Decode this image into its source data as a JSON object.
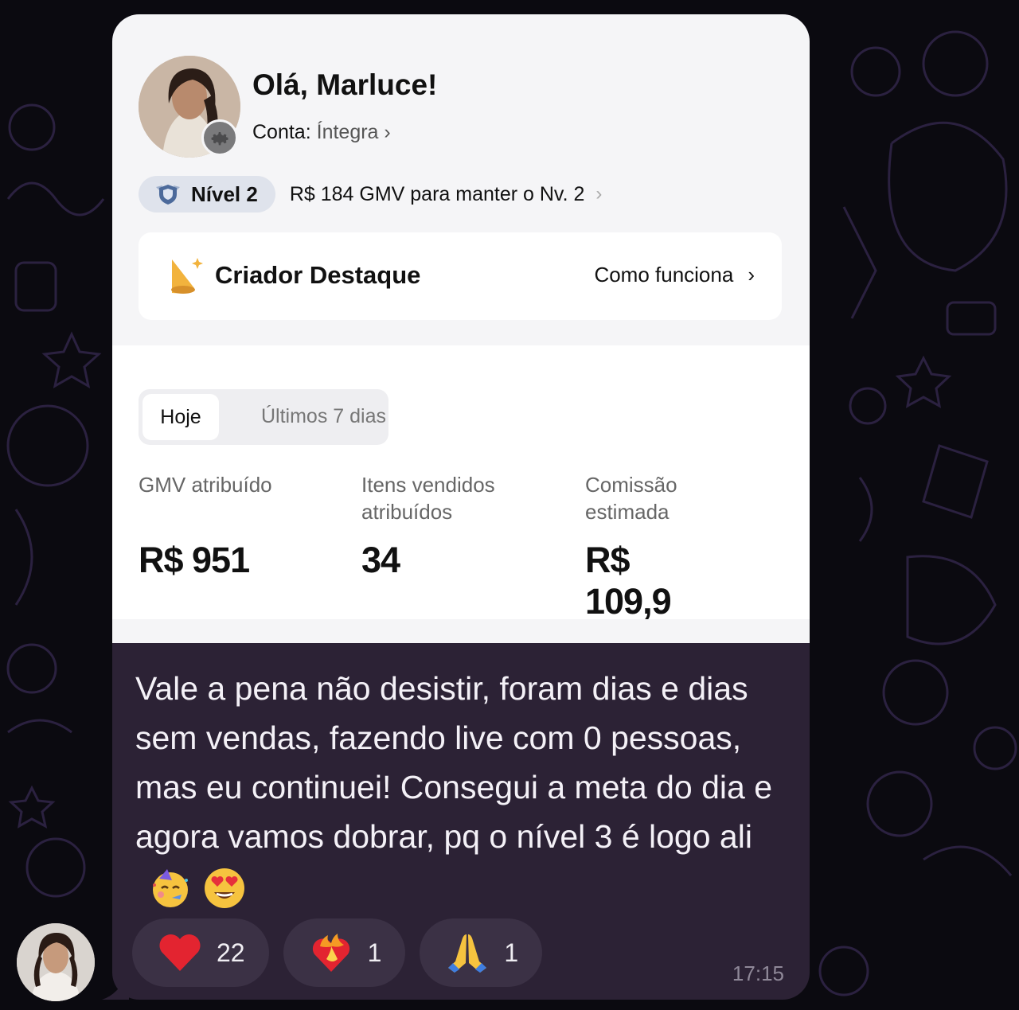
{
  "card": {
    "greeting": "Olá, Marluce!",
    "account_label": "Conta:",
    "account_value": "Íntegra",
    "level_label": "Nível 2",
    "level_message": "R$ 184 GMV para manter o Nv. 2",
    "creator_title": "Criador Destaque",
    "creator_link": "Como funciona",
    "tabs": [
      {
        "label": "Hoje",
        "active": true
      },
      {
        "label": "Últimos 7 dias",
        "active": false
      }
    ],
    "stats": [
      {
        "label": "GMV atribuído",
        "value": "R$ 951"
      },
      {
        "label": "Itens vendidos atribuídos",
        "value": "34"
      },
      {
        "label": "Comissão estimada",
        "value": "R$ 109,9"
      }
    ]
  },
  "message": {
    "text": "Vale a pena não desistir, foram dias e dias sem vendas, fazendo live com 0 pessoas, mas eu continuei! Consegui a meta do dia e agora vamos dobrar, pq o nível 3 é logo ali",
    "emojis": [
      "partying-face-emoji",
      "heart-eyes-emoji"
    ],
    "time": "17:15"
  },
  "reactions": [
    {
      "icon": "red-heart-icon",
      "count": "22"
    },
    {
      "icon": "heart-on-fire-icon",
      "count": "1"
    },
    {
      "icon": "folded-hands-icon",
      "count": "1"
    }
  ],
  "colors": {
    "chat_background": "#0b0a10",
    "bubble": "#2c2235",
    "reaction_pill": "#3b3145",
    "card_background": "#f5f5f7"
  }
}
